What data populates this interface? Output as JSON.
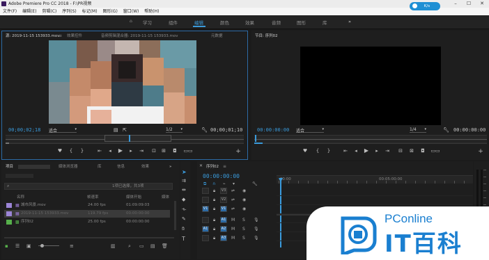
{
  "window": {
    "title": "Adobe Premiere Pro CC 2018 - F:\\PR视频"
  },
  "menu": [
    "文件(F)",
    "编辑(E)",
    "剪辑(C)",
    "序列(S)",
    "标记(M)",
    "图形(G)",
    "窗口(W)",
    "帮助(H)"
  ],
  "net_badge": "K/s",
  "workspaces": [
    "学习",
    "组件",
    "编辑",
    "颜色",
    "效果",
    "音频",
    "图形",
    "库"
  ],
  "source_panel": {
    "tabs": [
      "源: 2019-11-15 153933.mov",
      "效果控件",
      "音频剪辑混合器: 2019-11-15 153933.mov",
      "元数据"
    ],
    "timecode": "00;00;02;18",
    "fit": "适合",
    "scale": "1/2",
    "duration": "00;00;01;10"
  },
  "program_panel": {
    "tab": "节目: 序列02",
    "timecode": "00:00:00:00",
    "fit": "适合",
    "scale": "1/4",
    "duration": "00:00:00:00"
  },
  "project_panel": {
    "tabs": [
      "项目",
      "媒体浏览器",
      "库",
      "信息",
      "效果"
    ],
    "selection": "1项已选择，共3项",
    "columns": [
      "名称",
      "帧速率",
      "媒体开始",
      "媒体"
    ],
    "items": [
      {
        "name": "城市风景.mov",
        "fps": "24.00 fps",
        "start": "01:09:09:03",
        "color": "#9b84d6"
      },
      {
        "name": "2019-11-15 153933.mov",
        "fps": "119.79 fps",
        "start": "00:00:00:00",
        "color": "#9b84d6"
      },
      {
        "name": "序列02",
        "fps": "25.00 fps",
        "start": "00:00:00:00",
        "color": "#56b04b"
      }
    ]
  },
  "timeline": {
    "tab": "序列02",
    "timecode": "00:00:00:00",
    "ruler": [
      ":00:00",
      "00:05:00:00"
    ],
    "tracks": [
      {
        "src": "",
        "name": "V3"
      },
      {
        "src": "",
        "name": "V2"
      },
      {
        "src": "V1",
        "name": "V1"
      },
      {
        "src": "",
        "name": "A1"
      },
      {
        "src": "A1",
        "name": "A2"
      },
      {
        "src": "",
        "name": "A3"
      }
    ]
  },
  "watermark": {
    "brand": "PConline",
    "product": "IT百科"
  }
}
